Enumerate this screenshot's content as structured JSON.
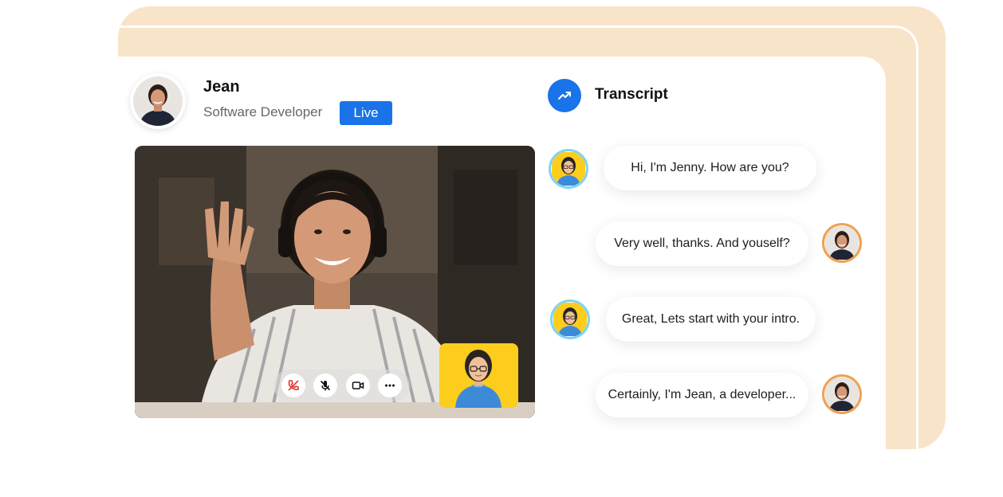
{
  "profile": {
    "name": "Jean",
    "role": "Software Developer",
    "status": "Live"
  },
  "call_controls": [
    {
      "icon": "phone-hangup-icon",
      "color": "#e53935"
    },
    {
      "icon": "mic-off-icon",
      "color": "#111111"
    },
    {
      "icon": "video-camera-icon",
      "color": "#111111"
    },
    {
      "icon": "more-icon",
      "color": "#111111"
    }
  ],
  "transcript": {
    "title": "Transcript",
    "icon": "trending-up-icon",
    "messages": [
      {
        "speaker": "bot",
        "text": "Hi, I'm Jenny. How are you?"
      },
      {
        "speaker": "user",
        "text": "Very well, thanks. And youself?"
      },
      {
        "speaker": "bot",
        "text": "Great, Lets start with your intro."
      },
      {
        "speaker": "user",
        "text": "Certainly, I'm Jean, a developer..."
      }
    ]
  },
  "colors": {
    "accent": "#1a73e8",
    "peach": "#f8e4c8",
    "self_view_bg": "#fccd1c",
    "bot_ring": "#7fd3f7",
    "user_ring": "#f0a050"
  }
}
